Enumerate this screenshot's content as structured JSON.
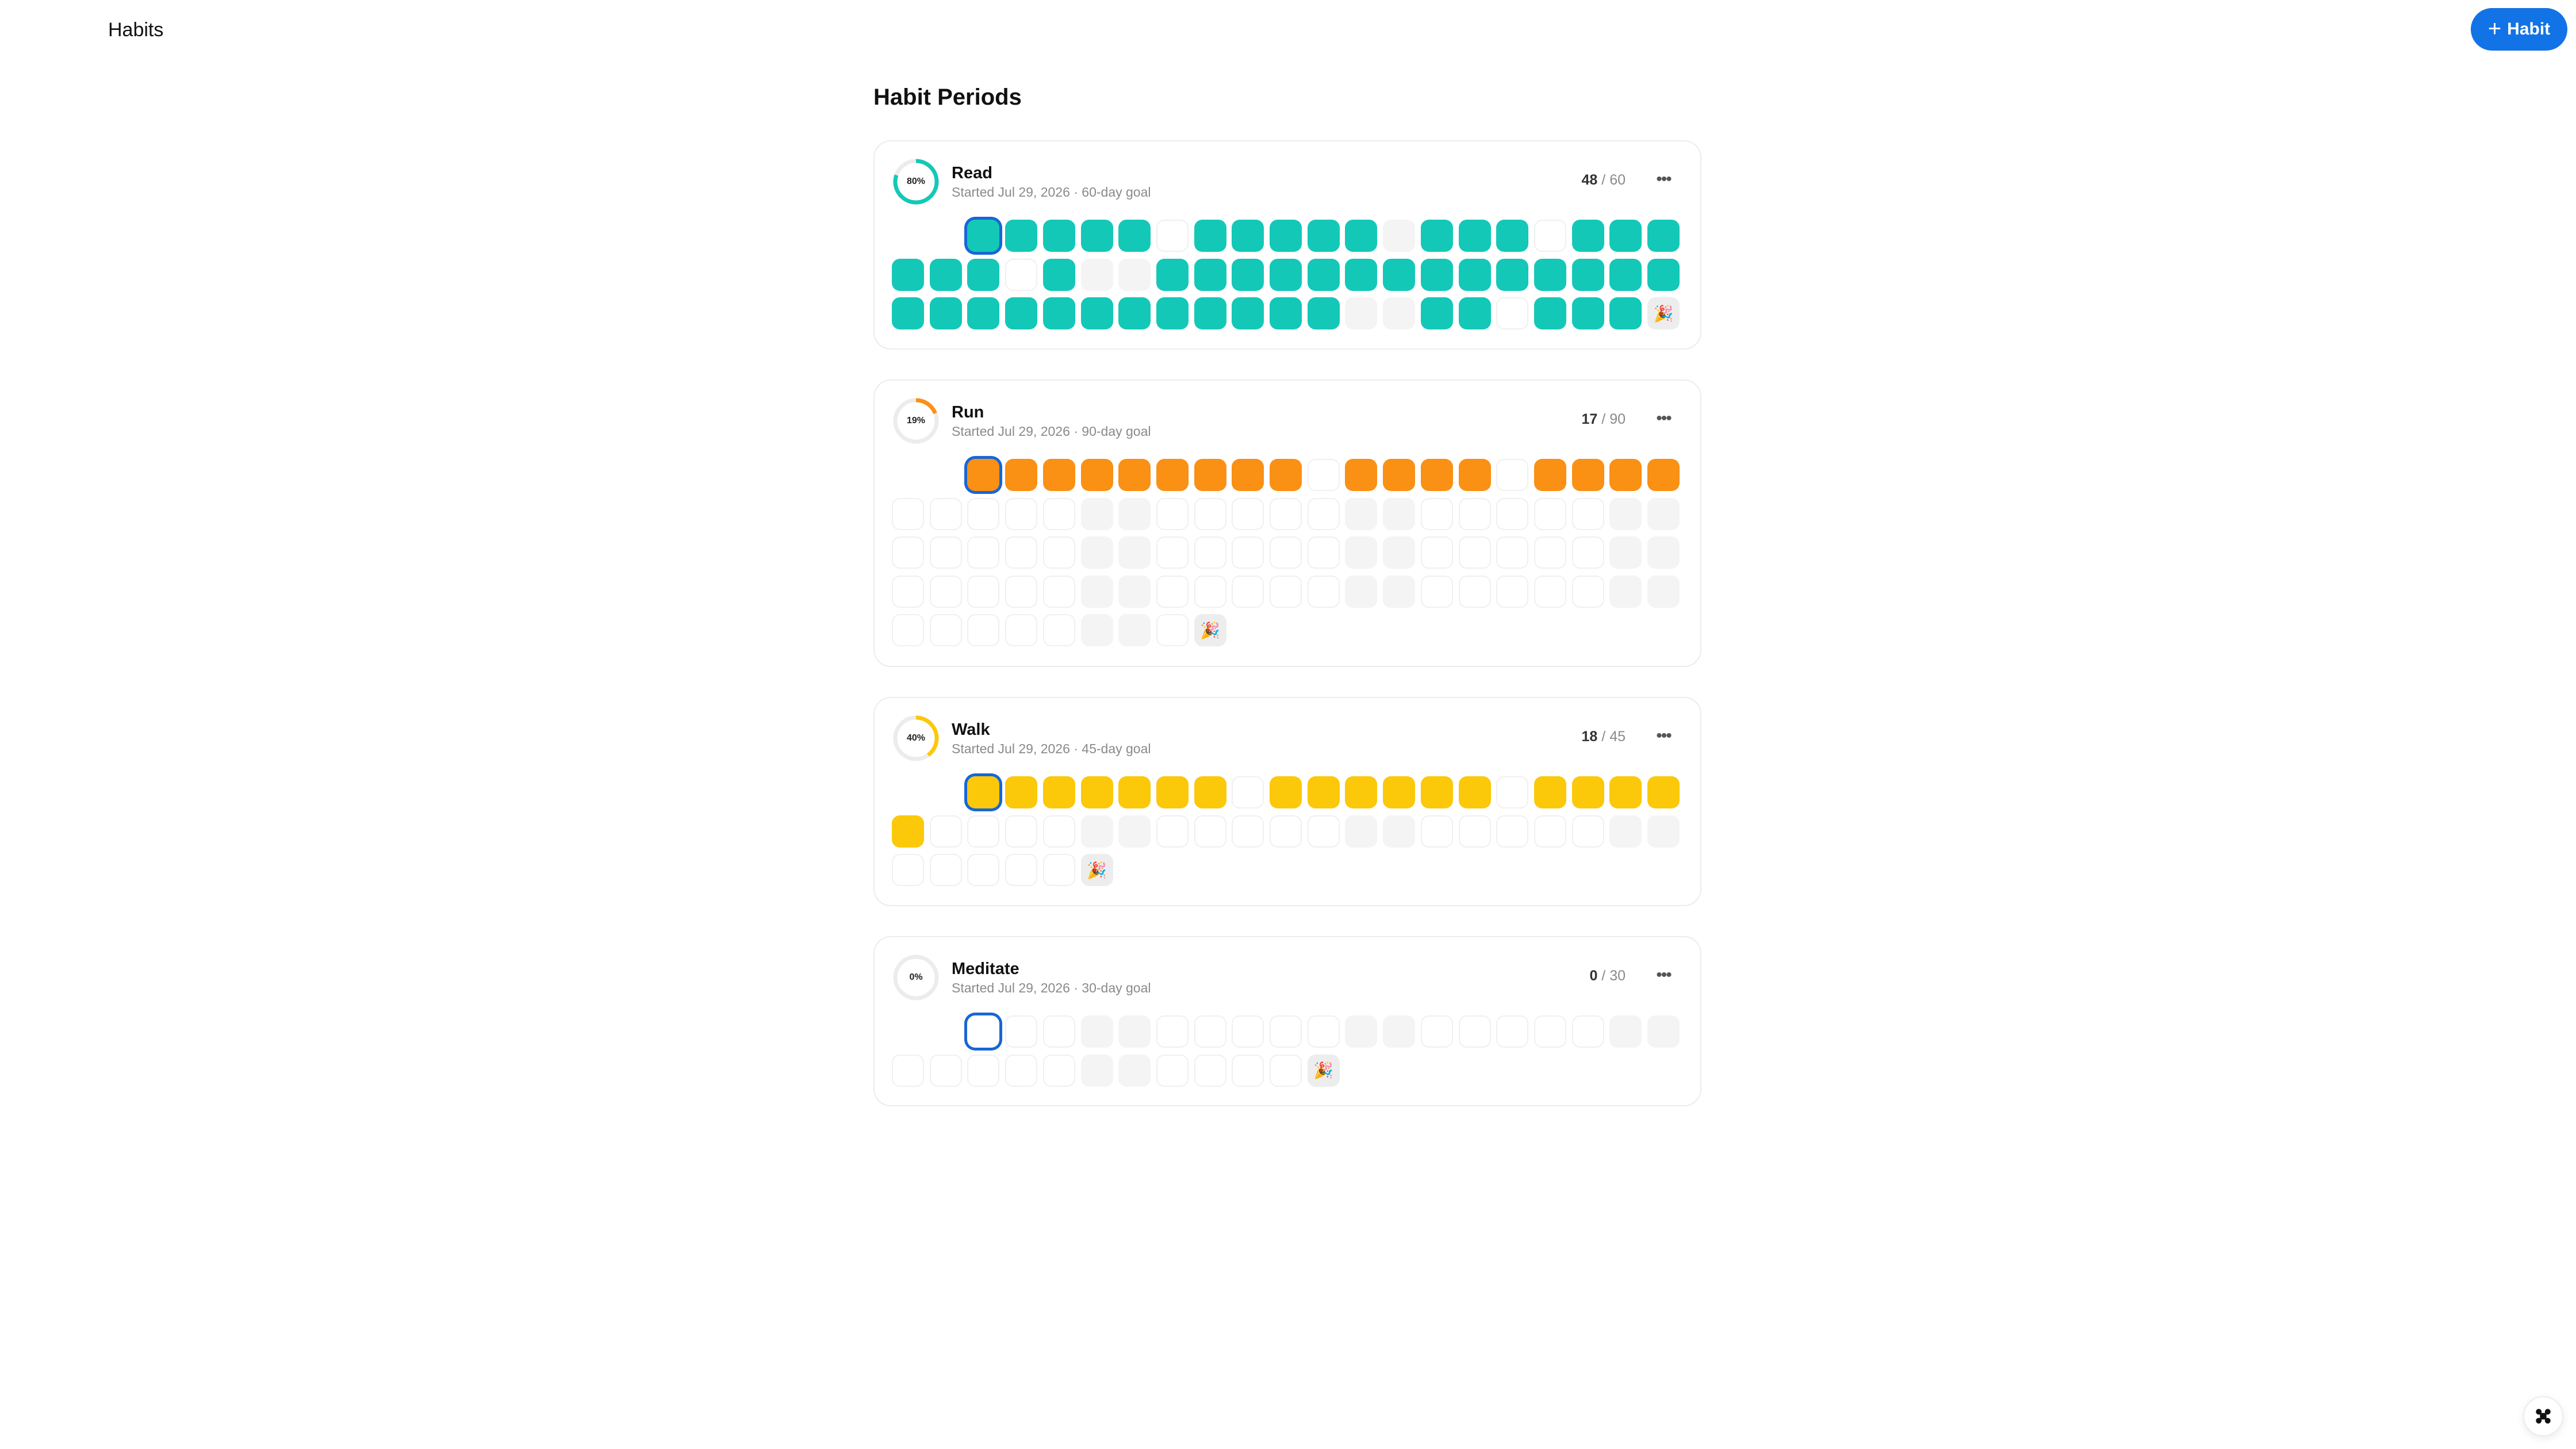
{
  "app": {
    "title": "Habits"
  },
  "toolbar": {
    "add_label": "Habit",
    "add_icon": "plus-icon"
  },
  "page": {
    "heading": "Habit Periods"
  },
  "colors": {
    "accent": "#1273e6",
    "today_outline": "#1766d6"
  },
  "habits": [
    {
      "name": "Read",
      "subtitle": "Started Jul 29, 2026 · 60-day goal",
      "percent": "80%",
      "progress": 0.8,
      "done": "48",
      "goal": "/ 60",
      "color": "#14c8b8",
      "lead": 2,
      "total": 60,
      "today": 0,
      "done_days": [
        0,
        1,
        2,
        3,
        4,
        6,
        7,
        8,
        9,
        10,
        12,
        13,
        14,
        16,
        17,
        18,
        19,
        20,
        21,
        23,
        26,
        27,
        28,
        29,
        30,
        31,
        32,
        33,
        34,
        35,
        36,
        37,
        38,
        39,
        40,
        41,
        42,
        43,
        44,
        45,
        46,
        47,
        48,
        49,
        50,
        51,
        54,
        55,
        57,
        58,
        59
      ]
    },
    {
      "name": "Run",
      "subtitle": "Started Jul 29, 2026 · 90-day goal",
      "percent": "19%",
      "progress": 0.19,
      "done": "17",
      "goal": "/ 90",
      "color": "#fa9014",
      "lead": 2,
      "total": 90,
      "today": 0,
      "done_days": [
        0,
        1,
        2,
        3,
        4,
        5,
        6,
        7,
        8,
        10,
        11,
        12,
        13,
        15,
        16,
        17,
        18
      ]
    },
    {
      "name": "Walk",
      "subtitle": "Started Jul 29, 2026 · 45-day goal",
      "percent": "40%",
      "progress": 0.4,
      "done": "18",
      "goal": "/ 45",
      "color": "#fcc80a",
      "lead": 2,
      "total": 45,
      "today": 0,
      "done_days": [
        0,
        1,
        2,
        3,
        4,
        5,
        6,
        8,
        9,
        10,
        11,
        12,
        13,
        15,
        16,
        17,
        18,
        19
      ]
    },
    {
      "name": "Meditate",
      "subtitle": "Started Jul 29, 2026 · 30-day goal",
      "percent": "0%",
      "progress": 0,
      "done": "0",
      "goal": "/ 30",
      "color": "#d0d0d0",
      "lead": 2,
      "total": 30,
      "today": 0,
      "done_days": []
    }
  ],
  "goal_marker": {
    "emoji": "🎉",
    "icon": "party-popper-icon"
  },
  "fab": {
    "icon": "command-icon"
  }
}
